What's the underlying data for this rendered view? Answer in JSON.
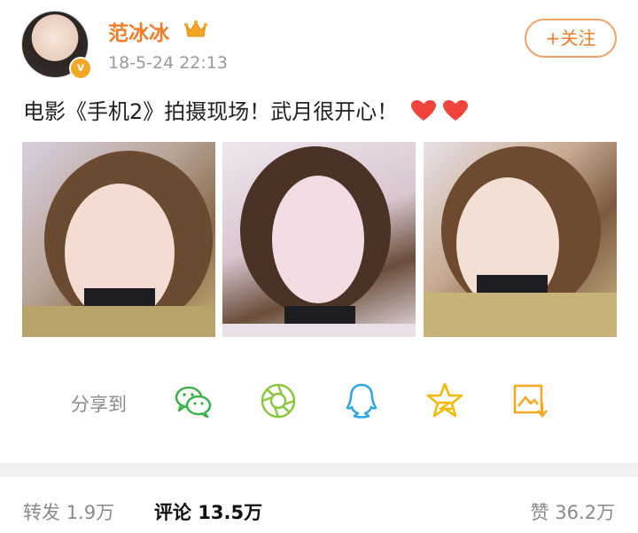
{
  "post": {
    "username": "范冰冰",
    "timestamp": "18-5-24 22:13",
    "follow_label": "+关注",
    "text": "电影《手机2》拍摄现场！武月很开心！"
  },
  "share": {
    "label": "分享到",
    "icons": [
      "wechat-icon",
      "moments-icon",
      "qq-icon",
      "qzone-star-icon",
      "save-image-icon"
    ]
  },
  "stats": {
    "repost_label": "转发",
    "repost_count": "1.9万",
    "comment_label": "评论",
    "comment_count": "13.5万",
    "like_label": "赞",
    "like_count": "36.2万"
  },
  "colors": {
    "accent": "#f27c27",
    "verified": "#f5a623",
    "wechat": "#3bb14a",
    "qq": "#2aa7e6",
    "star": "#f5b800",
    "heart": "#f0443a"
  }
}
